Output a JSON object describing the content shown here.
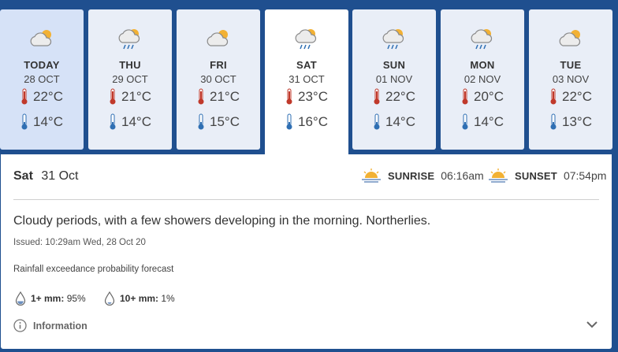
{
  "forecast_days": [
    {
      "day": "TODAY",
      "date": "28 OCT",
      "max": "22°C",
      "min": "14°C",
      "icon": "cloudy-sun-icon"
    },
    {
      "day": "THU",
      "date": "29 OCT",
      "max": "21°C",
      "min": "14°C",
      "icon": "showers-icon"
    },
    {
      "day": "FRI",
      "date": "30 OCT",
      "max": "21°C",
      "min": "15°C",
      "icon": "cloudy-sun-icon"
    },
    {
      "day": "SAT",
      "date": "31 OCT",
      "max": "23°C",
      "min": "16°C",
      "icon": "showers-icon"
    },
    {
      "day": "SUN",
      "date": "01 NOV",
      "max": "22°C",
      "min": "14°C",
      "icon": "showers-icon"
    },
    {
      "day": "MON",
      "date": "02 NOV",
      "max": "20°C",
      "min": "14°C",
      "icon": "showers-icon"
    },
    {
      "day": "TUE",
      "date": "03 NOV",
      "max": "22°C",
      "min": "13°C",
      "icon": "cloudy-sun-icon"
    }
  ],
  "detail": {
    "weekday": "Sat",
    "date": "31 Oct",
    "sunrise_label": "SUNRISE",
    "sunrise_time": "06:16am",
    "sunset_label": "SUNSET",
    "sunset_time": "07:54pm",
    "description": "Cloudy periods, with a few showers developing in the morning. Northerlies.",
    "issued": "Issued: 10:29am Wed, 28 Oct 20",
    "rain_title": "Rainfall exceedance probability forecast",
    "rain_1_label": "1+ mm:",
    "rain_1_value": "95%",
    "rain_10_label": "10+ mm:",
    "rain_10_value": "1%",
    "info_label": "Information"
  },
  "colors": {
    "background": "#1f4f8f",
    "tab": "#e9eef7",
    "tab_today": "#d6e2f7",
    "thermo_hot": "#c0392b",
    "thermo_cold": "#2f6fb3",
    "sun": "#f2b134"
  }
}
